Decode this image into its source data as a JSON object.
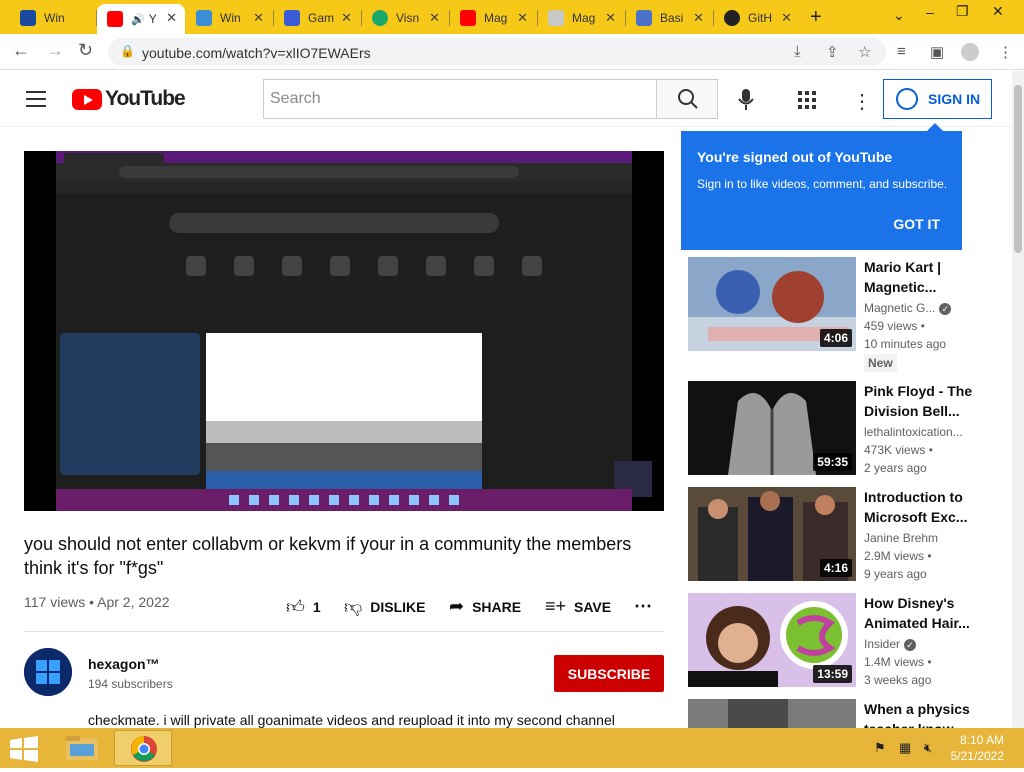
{
  "browser": {
    "tabs": [
      {
        "title": "Win",
        "favicon_color": "#1a4aa0"
      },
      {
        "title": "Y",
        "favicon_color": "#ff0000",
        "active": true
      },
      {
        "title": "Win",
        "favicon_color": "#3b8ed6"
      },
      {
        "title": "Gam",
        "favicon_color": "#3b5bd6"
      },
      {
        "title": "Visn",
        "favicon_color": "#1aa86a"
      },
      {
        "title": "Mag",
        "favicon_color": "#ff0000"
      },
      {
        "title": "Mag",
        "favicon_color": "#c8c8c8"
      },
      {
        "title": "Basi",
        "favicon_color": "#4a70c8"
      },
      {
        "title": "GitH",
        "favicon_color": "#222222"
      }
    ],
    "url": "youtube.com/watch?v=xlIO7EWAErs"
  },
  "youtube": {
    "logo_text": "YouTube",
    "search_placeholder": "Search",
    "sign_in": "SIGN IN"
  },
  "tooltip": {
    "heading": "You're signed out of YouTube",
    "body": "Sign in to like videos, comment, and subscribe.",
    "got_it": "GOT IT"
  },
  "video": {
    "title": "you should not enter collabvm or kekvm if your in a community the members think it's for \"f*gs\"",
    "meta": "117 views • Apr 2, 2022",
    "likes": "1",
    "dislike": "DISLIKE",
    "share": "SHARE",
    "save": "SAVE",
    "channel": "hexagon™",
    "subscribers": "194 subscribers",
    "subscribe": "SUBSCRIBE",
    "description": "checkmate. i will private all goanimate videos and reupload it into my second channel"
  },
  "suggested": [
    {
      "title": "Mario Kart | Magnetic...",
      "channel": "Magnetic G...",
      "verified": true,
      "views": "459 views •",
      "age": "10 minutes ago",
      "badge": "New",
      "duration": "4:06"
    },
    {
      "title": "Pink Floyd - The Division Bell...",
      "channel": "lethalintoxication...",
      "verified": false,
      "views": "473K views •",
      "age": "2 years ago",
      "badge": "",
      "duration": "59:35"
    },
    {
      "title": "Introduction to Microsoft Exc...",
      "channel": "Janine Brehm",
      "verified": false,
      "views": "2.9M views •",
      "age": "9 years ago",
      "badge": "",
      "duration": "4:16"
    },
    {
      "title": "How Disney's Animated Hair...",
      "channel": "Insider",
      "verified": true,
      "views": "1.4M views •",
      "age": "3 weeks ago",
      "badge": "",
      "duration": "13:59"
    },
    {
      "title": "When a physics teacher know...",
      "channel": "",
      "verified": false,
      "views": "",
      "age": "",
      "badge": "",
      "duration": ""
    }
  ],
  "taskbar": {
    "time": "8:10 AM",
    "date": "5/21/2022"
  },
  "colors": {
    "taskbar": "#e7b53a",
    "tabstrip": "#f6c918",
    "youtube_red": "#ff0000",
    "tooltip_blue": "#1a73e8",
    "subscribe_red": "#cc0000"
  }
}
